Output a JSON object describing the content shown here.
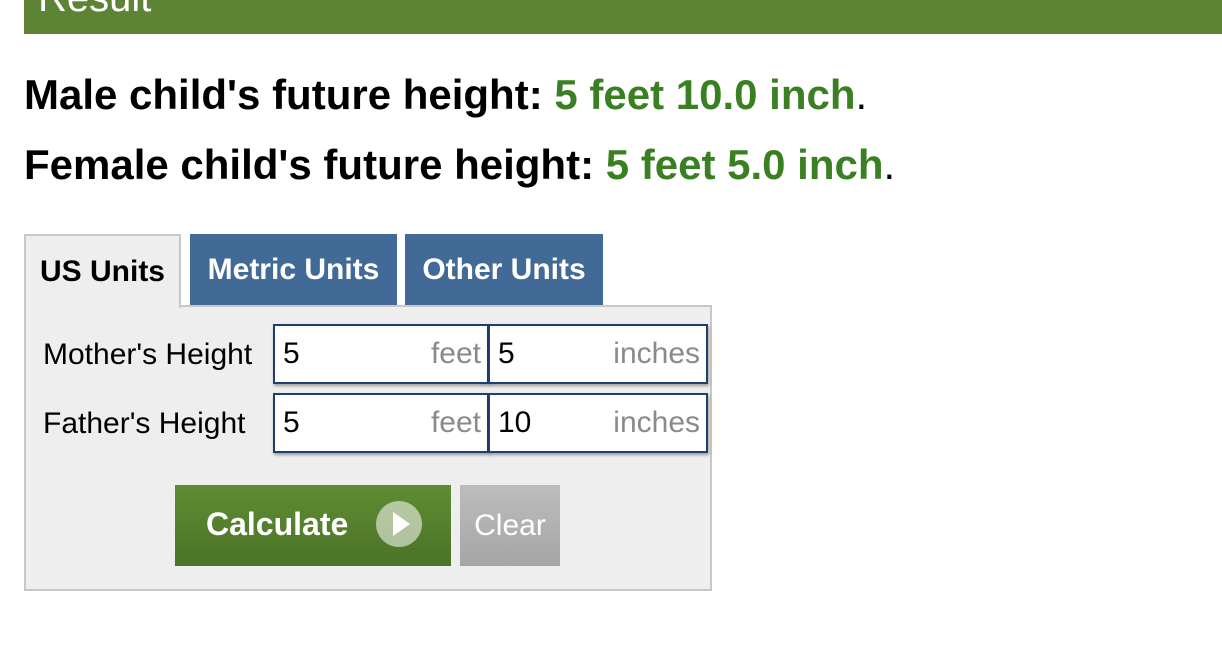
{
  "result": {
    "title": "Result",
    "male_label": "Male child's future height: ",
    "male_value": "5 feet 10.0 inch",
    "female_label": "Female child's future height: ",
    "female_value": "5 feet 5.0 inch",
    "period": "."
  },
  "tabs": {
    "us": "US Units",
    "metric": "Metric Units",
    "other": "Other Units",
    "active": "US Units"
  },
  "form": {
    "mother": {
      "label": "Mother's Height",
      "feet_value": "5",
      "feet_unit": "feet",
      "inches_value": "5",
      "inches_unit": "inches"
    },
    "father": {
      "label": "Father's Height",
      "feet_value": "5",
      "feet_unit": "feet",
      "inches_value": "10",
      "inches_unit": "inches"
    }
  },
  "buttons": {
    "calculate": "Calculate",
    "clear": "Clear",
    "calculate_icon": "play-circle-icon"
  },
  "colors": {
    "header_green": "#5c8434",
    "result_green": "#3a8022",
    "tab_blue": "#426a96",
    "field_border": "#1f3f73"
  }
}
